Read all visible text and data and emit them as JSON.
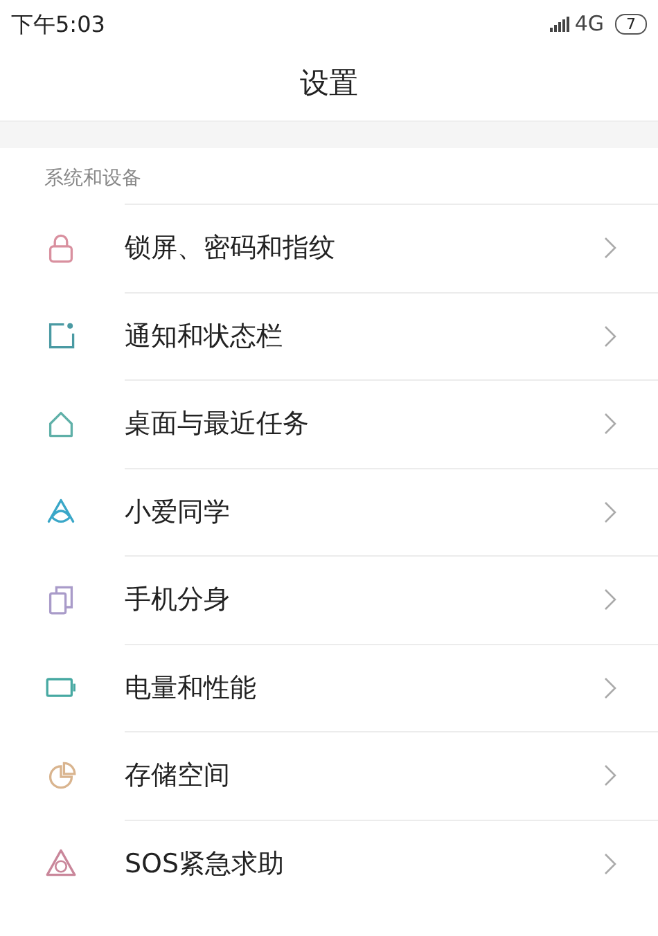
{
  "status_bar": {
    "time": "下午5:03",
    "network": "4G",
    "battery": "7"
  },
  "header": {
    "title": "设置"
  },
  "section": {
    "title": "系统和设备",
    "items": [
      {
        "label": "锁屏、密码和指纹",
        "kind": "lock",
        "color": "#d9909f"
      },
      {
        "label": "通知和状态栏",
        "kind": "notification",
        "color": "#4a9aa3"
      },
      {
        "label": "桌面与最近任务",
        "kind": "home",
        "color": "#5fb0a8"
      },
      {
        "label": "小爱同学",
        "kind": "assistant",
        "color": "#3aa7c8"
      },
      {
        "label": "手机分身",
        "kind": "dual",
        "color": "#a99bc9"
      },
      {
        "label": "电量和性能",
        "kind": "battery",
        "color": "#47a9a2"
      },
      {
        "label": "存储空间",
        "kind": "storage",
        "color": "#d9b48e"
      },
      {
        "label": "SOS紧急求助",
        "kind": "sos",
        "color": "#c9869a"
      }
    ]
  }
}
